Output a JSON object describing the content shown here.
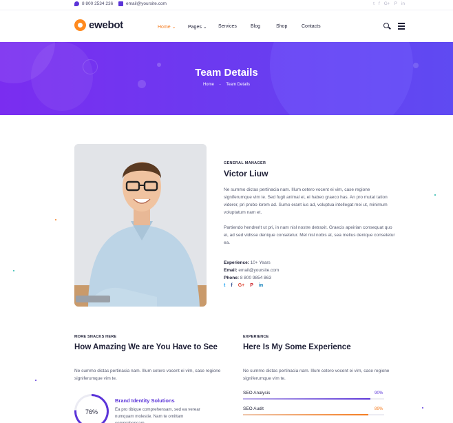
{
  "topbar": {
    "phone": "8 800 2534 236",
    "email": "email@yoursite.com",
    "socials": [
      "t",
      "f",
      "G+",
      "P",
      "in"
    ]
  },
  "header": {
    "logo_text": "ewebot",
    "nav": [
      {
        "label": "Home"
      },
      {
        "label": "Pages"
      },
      {
        "label": "Services"
      },
      {
        "label": "Blog"
      },
      {
        "label": "Shop"
      },
      {
        "label": "Contacts"
      }
    ],
    "home_caret": "⌄",
    "pages_caret": "⌄"
  },
  "banner": {
    "title": "Team Details",
    "breadcrumb": [
      "Home",
      "Team Details"
    ],
    "separator": "-"
  },
  "profile": {
    "role": "GENERAL MANAGER",
    "name": "Victor Liuw",
    "para1": "Ne summo dictas pertinacia nam. Illum cetero vocent ei vim, case regione signiferumque vim te. Sed fugit animal ei, ei habeo graeco has. An pro mutat tation viderer, pri probo lorem ad. Sumo erant ius ad, voluptua intellegat mei ut, minimum voluptatum nam et.",
    "para2": "Partiendo hendrerit ut pri, in nam nisl nostre detraxit. Graecis apeirian consequat quo ei, ad sed vidisse denique consetetur. Mel nisl nobis at, sea melius denique consetetur ea.",
    "experience_label": "Experience:",
    "experience_value": "10+ Years",
    "email_label": "Email:",
    "email_value": "email@yoursite.com",
    "phone_label": "Phone:",
    "phone_value": "8 800 9854 863",
    "socials": [
      {
        "icon": "twitter-icon",
        "glyph": "t",
        "color": "#1da1f2"
      },
      {
        "icon": "facebook-icon",
        "glyph": "f",
        "color": "#3b5998"
      },
      {
        "icon": "google-plus-icon",
        "glyph": "G+",
        "color": "#dd4b39"
      },
      {
        "icon": "pinterest-icon",
        "glyph": "P",
        "color": "#cb2027"
      },
      {
        "icon": "linkedin-icon",
        "glyph": "in",
        "color": "#0077b5"
      }
    ]
  },
  "snacks": {
    "kicker": "MORE SNACKS HERE",
    "title": "How Amazing We are You Have to See",
    "intro": "Ne summo dictas pertinacia nam. Illum cetero vocent ei vim, case regione signiferumque vim te.",
    "ring_value": "76%",
    "ring_fraction": 0.76,
    "brand_title": "Brand Identity  Solutions",
    "brand_desc": "Ea pro tibique comprehensam, sed ea verear numquam molestie. Nam te omittam comprehensam."
  },
  "experience": {
    "kicker": "EXPERIENCE",
    "title": "Here Is My Some Experience",
    "intro": "Ne summo dictas pertinacia nam. Illum cetero vocent ei vim, case regione signiferumque vim te.",
    "skills": [
      {
        "label": "SEO Analysis",
        "value": "90%",
        "fraction": 0.9,
        "color": "#5b34d8"
      },
      {
        "label": "SEO Audit",
        "value": "89%",
        "fraction": 0.89,
        "color": "#f57c1f"
      }
    ]
  },
  "colors": {
    "accent": "#5b34d8",
    "orange": "#f57c1f",
    "dark": "#1e1f36"
  }
}
